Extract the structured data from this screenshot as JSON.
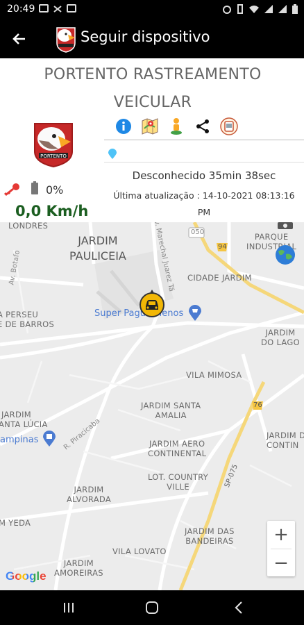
{
  "status_bar": {
    "time": "20:49",
    "battery": "85%"
  },
  "app_bar": {
    "title": "Seguir dispositivo",
    "back_icon": "arrow-left-icon",
    "logo_text": "PORTENTO"
  },
  "panel": {
    "company_line1": "PORTENTO RASTREAMENTO",
    "company_line2": "VEICULAR",
    "logo_text": "PORTENTO",
    "actions": [
      {
        "name": "info-icon",
        "color": "#1e88e5"
      },
      {
        "name": "map-icon",
        "color": "#e53935"
      },
      {
        "name": "street-view-icon",
        "color": "#f9a825"
      },
      {
        "name": "share-icon",
        "color": "#111111"
      },
      {
        "name": "device-icon",
        "color": "#c85a3a"
      }
    ],
    "address": "",
    "status": "Desconhecido 35min 38sec",
    "update_line1": "Última atualização : 14-10-2021 08:13:16",
    "update_line2": "PM",
    "battery_level": "0%",
    "speed": "0,0 Km/h"
  },
  "map": {
    "labels": {
      "londres": "LONDRES",
      "pauliceia_1": "JARDIM",
      "pauliceia_2": "PAULICEIA",
      "marechal": "Av. Marechal Juarez Tá",
      "botafogo": "Av. Botafo",
      "parque_1": "PARQUE",
      "parque_2": "INDUSTRIAL",
      "cidade_jardim": "CIDADE JARDIM",
      "persel_1": "A PERSEU",
      "persel_2": "E DE BARROS",
      "super_pague": "Super Pague Menos",
      "lago_1": "JARDIM",
      "lago_2": "DO LAGO",
      "mimosa": "VILA MIMOSA",
      "santa_amalia_1": "JARDIM SANTA",
      "santa_amalia_2": "AMALIA",
      "santa_lucia_1": "JARDIM",
      "santa_lucia_2": "ANTA LÚCIA",
      "campinas": "ampinas",
      "piracicaba": "R. Piracicaba",
      "aero_1": "JARDIM AERO",
      "aero_2": "CONTINENTAL",
      "jardim_d_1": "JARDIM D",
      "jardim_d_2": "CONTIN",
      "country_1": "LOT. COUNTRY",
      "country_2": "VILLE",
      "alvorada_1": "JARDIM",
      "alvorada_2": "ALVORADA",
      "yeda": "M YEDA",
      "bandeiras_1": "JARDIM DAS",
      "bandeiras_2": "BANDEIRAS",
      "lovato": "VILA LOVATO",
      "amoreiras_1": "JARDIM",
      "amoreiras_2": "AMOREIRAS",
      "sp075": "SP-075",
      "r050": "050",
      "r94": "94",
      "r76": "76"
    },
    "zoom_in": "+",
    "zoom_out": "−",
    "attribution": "Google"
  },
  "nav_bar": {
    "recents": "recents-icon",
    "home": "home-icon",
    "back": "back-icon"
  }
}
